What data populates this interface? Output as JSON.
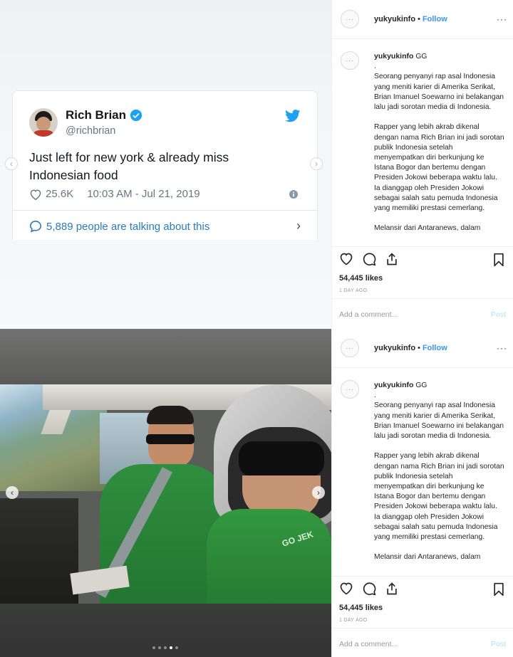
{
  "post1": {
    "tweet": {
      "name": "Rich Brian",
      "handle": "@richbrian",
      "text": "Just left for new york & already miss Indonesian food",
      "likes": "25.6K",
      "time": "10:03 AM - Jul 21, 2019",
      "talking": "5,889 people are talking about this"
    },
    "username": "yukyukinfo",
    "follow": "Follow",
    "caption_user": "yukyukinfo",
    "caption": "GG\n.\nSeorang penyanyi rap asal Indonesia yang meniti karier di Amerika Serikat, Brian Imanuel Soewarno ini belakangan lalu jadi sorotan media di Indonesia.\n\nRapper yang lebih akrab dikenal dengan nama Rich Brian ini jadi sorotan publik Indonesia setelah menyempatkan diri berkunjung ke Istana Bogor dan bertemu dengan Presiden Jokowi beberapa waktu lalu. Ia dianggap oleh Presiden Jokowi sebagai salah satu pemuda Indonesia yang memiliki prestasi cemerlang.\n\nMelansir dari Antaranews, dalam",
    "likes": "54,445 likes",
    "ago": "1 DAY AGO",
    "comment_placeholder": "Add a comment...",
    "post_label": "Post"
  },
  "post2": {
    "username": "yukyukinfo",
    "follow": "Follow",
    "caption_user": "yukyukinfo",
    "caption": "GG\n.\nSeorang penyanyi rap asal Indonesia yang meniti karier di Amerika Serikat, Brian Imanuel Soewarno ini belakangan lalu jadi sorotan media di Indonesia.\n\nRapper yang lebih akrab dikenal dengan nama Rich Brian ini jadi sorotan publik Indonesia setelah menyempatkan diri berkunjung ke Istana Bogor dan bertemu dengan Presiden Jokowi beberapa waktu lalu. Ia dianggap oleh Presiden Jokowi sebagai salah satu pemuda Indonesia yang memiliki prestasi cemerlang.\n\nMelansir dari Antaranews, dalam",
    "likes": "54,445 likes",
    "ago": "1 DAY AGO",
    "comment_placeholder": "Add a comment...",
    "post_label": "Post",
    "jacket_text": "GO JEK",
    "carousel_dots": 5,
    "carousel_active": 3
  },
  "colors": {
    "link": "#3897f0",
    "twitter": "#1da1f2",
    "gojek_green": "#2f8f3e"
  },
  "icons": [
    "heart-icon",
    "comment-icon",
    "share-icon",
    "bookmark-icon",
    "twitter-bird-icon",
    "verified-icon",
    "info-icon",
    "chevron-right-icon",
    "chevron-left-icon"
  ]
}
